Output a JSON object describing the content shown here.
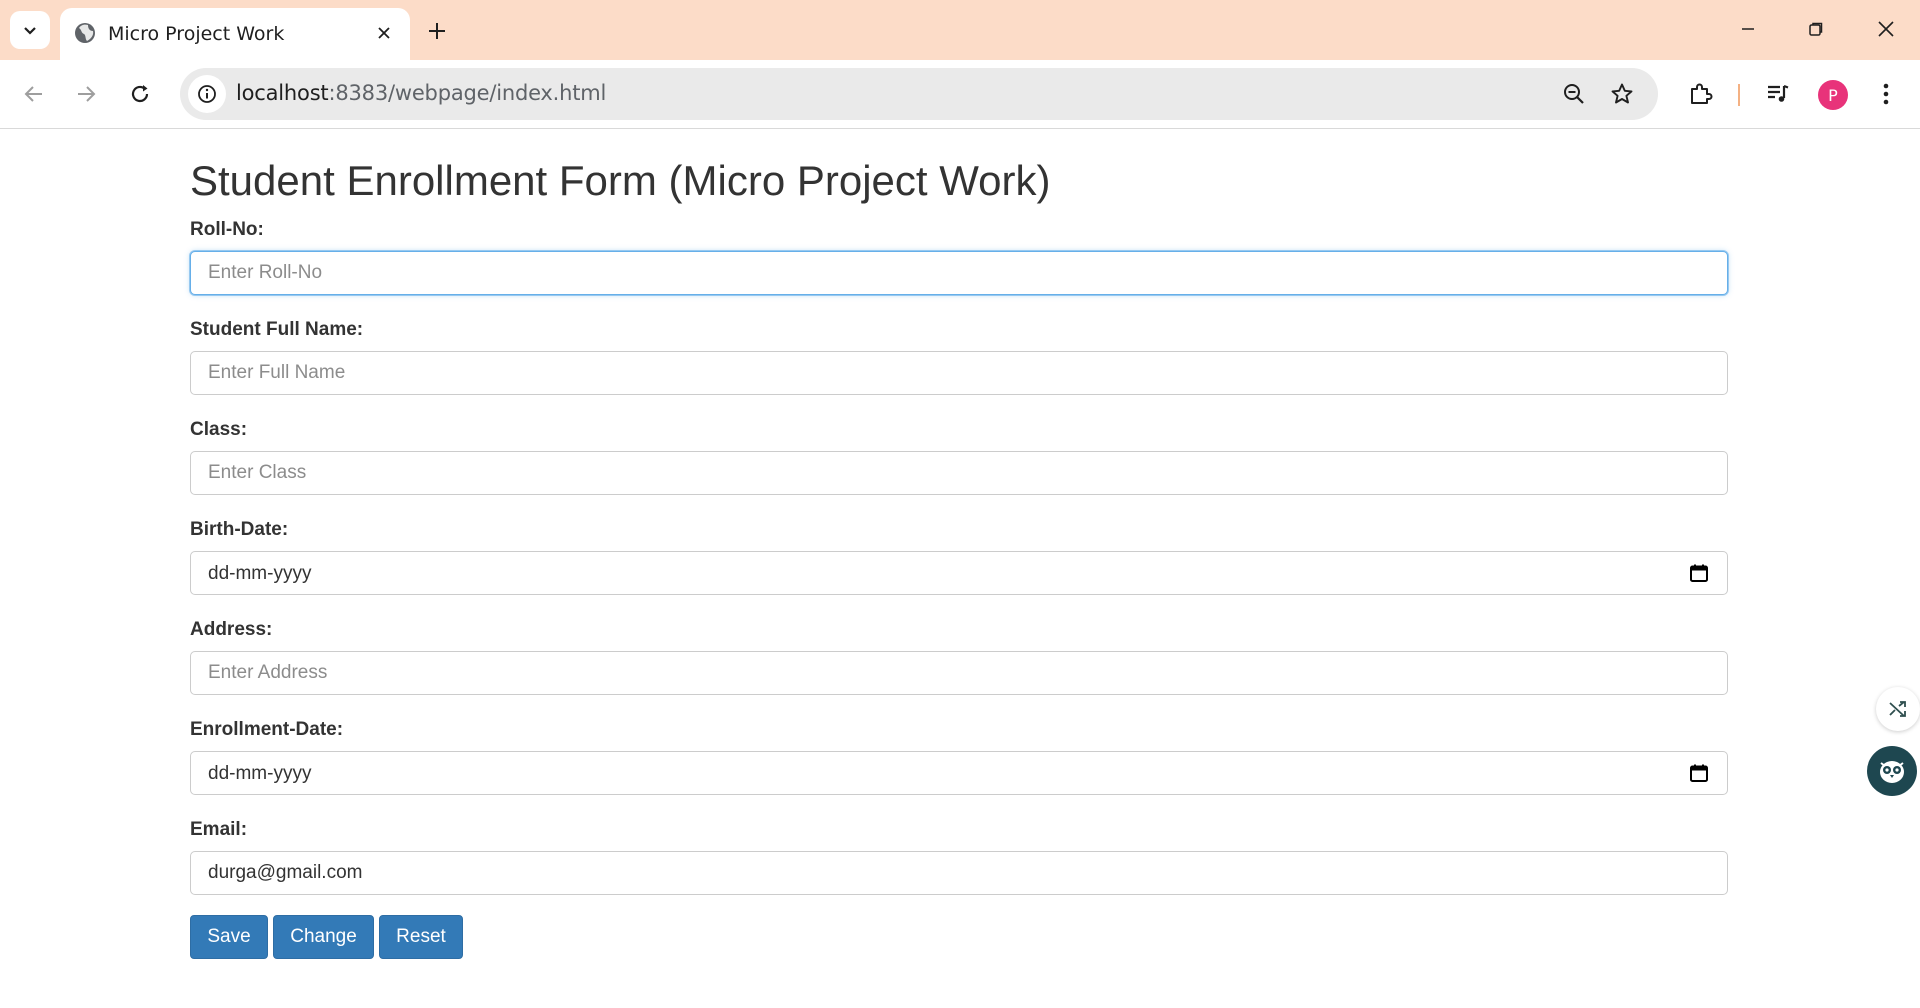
{
  "browser": {
    "tab_title": "Micro Project Work",
    "url_host": "localhost",
    "url_path": ":8383/webpage/index.html",
    "profile_initial": "P"
  },
  "form": {
    "title": "Student Enrollment Form (Micro Project Work)",
    "roll_no": {
      "label": "Roll-No:",
      "placeholder": "Enter Roll-No",
      "value": ""
    },
    "full_name": {
      "label": "Student Full Name:",
      "placeholder": "Enter Full Name",
      "value": ""
    },
    "class": {
      "label": "Class:",
      "placeholder": "Enter Class",
      "value": ""
    },
    "birth_date": {
      "label": "Birth-Date:",
      "value": "dd-mm-yyyy"
    },
    "address": {
      "label": "Address:",
      "placeholder": "Enter Address",
      "value": ""
    },
    "enrollment_date": {
      "label": "Enrollment-Date:",
      "value": "dd-mm-yyyy"
    },
    "email": {
      "label": "Email:",
      "placeholder": "",
      "value": "durga@gmail.com"
    },
    "buttons": {
      "save": "Save",
      "change": "Change",
      "reset": "Reset"
    }
  },
  "colors": {
    "tabbar": "#fcdcc8",
    "button": "#337ab7",
    "focus": "#66afe9"
  }
}
